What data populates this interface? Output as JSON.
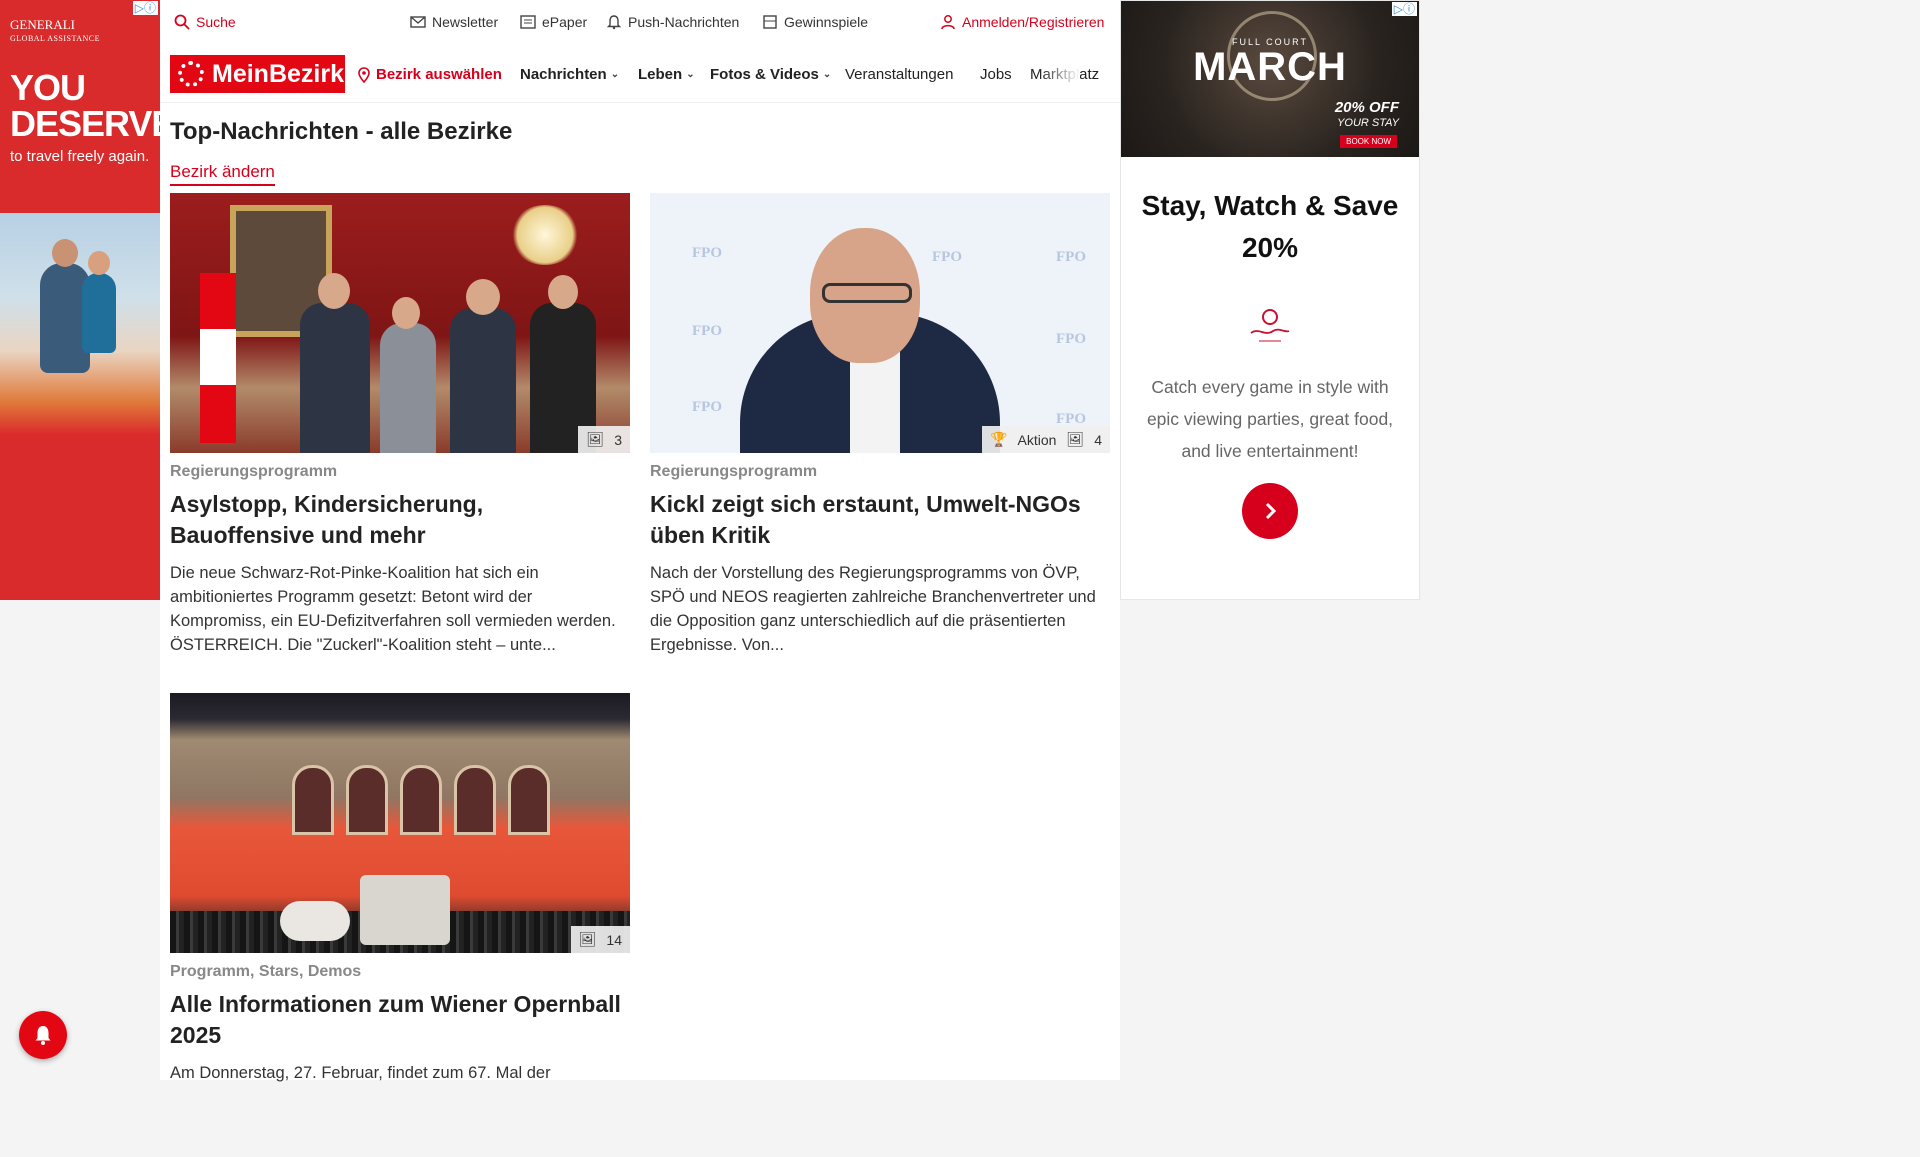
{
  "left_ad": {
    "adchoice": "▷ⓘ",
    "brand": "GENERALI",
    "brand_sub": "GLOBAL ASSISTANCE",
    "headline": "YOU DESERVE",
    "sub": "to travel freely again."
  },
  "topbar": {
    "search": "Suche",
    "newsletter": "Newsletter",
    "epaper": "ePaper",
    "push": "Push-Nachrichten",
    "gewinnspiele": "Gewinnspiele",
    "login": "Anmelden/Registrieren"
  },
  "nav": {
    "logo": "MeinBezirk",
    "bezirk": "Bezirk auswählen",
    "items": [
      "Nachrichten",
      "Leben",
      "Fotos & Videos",
      "Veranstaltungen",
      "Jobs",
      "Marktplatz"
    ]
  },
  "section": {
    "title": "Top-Nachrichten - alle Bezirke",
    "change": "Bezirk ändern"
  },
  "articles": [
    {
      "kicker": "Regierungsprogramm",
      "title": "Asylstopp, Kindersicherung, Bauoffensive und mehr",
      "teaser": "Die neue Schwarz-Rot-Pinke-Koalition hat sich ein ambitioniertes Programm gesetzt: Betont wird der Kompromiss, ein EU-Defizitverfahren soll vermieden werden.  ÖSTERREICH. Die \"Zuckerl\"-Koalition steht – unte...",
      "photo_count": "3"
    },
    {
      "kicker": "Regierungsprogramm",
      "title": "Kickl zeigt sich erstaunt, Umwelt-NGOs üben Kritik",
      "teaser": "Nach der Vorstellung des Regierungsprogramms von ÖVP, SPÖ und NEOS reagierten zahlreiche Branchenvertreter und die Opposition ganz unterschiedlich auf die präsentierten Ergebnisse. Von...",
      "action": "Aktion",
      "photo_count": "4"
    },
    {
      "kicker": "Programm, Stars, Demos",
      "title": "Alle Informationen zum Wiener Opernball 2025",
      "teaser": "Am Donnerstag, 27. Februar, findet zum 67. Mal der",
      "photo_count": "14"
    }
  ],
  "right_ad": {
    "adchoice": "▷ⓘ",
    "banner_small": "FULL COURT",
    "banner_title": "MARCH",
    "banner_offer": "20% OFF",
    "banner_stay": "YOUR STAY",
    "banner_book": "BOOK NOW",
    "headline": "Stay, Watch & Save 20%",
    "copy": "Catch every game in style with epic viewing parties, great food, and live entertainment!"
  },
  "colors": {
    "brand_red": "#e30613",
    "link_red": "#d6001c",
    "kicker_grey": "#888888"
  }
}
